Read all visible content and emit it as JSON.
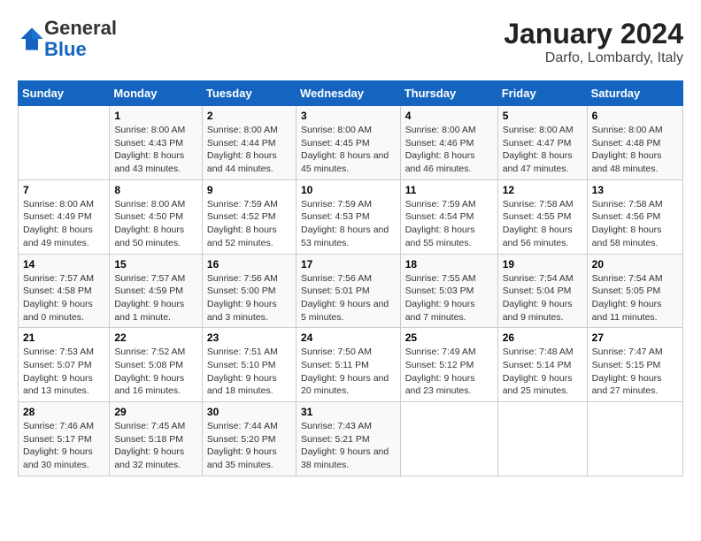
{
  "logo": {
    "general": "General",
    "blue": "Blue"
  },
  "title": "January 2024",
  "subtitle": "Darfo, Lombardy, Italy",
  "weekdays": [
    "Sunday",
    "Monday",
    "Tuesday",
    "Wednesday",
    "Thursday",
    "Friday",
    "Saturday"
  ],
  "weeks": [
    [
      {
        "num": "",
        "sunrise": "",
        "sunset": "",
        "daylight": "",
        "empty": true
      },
      {
        "num": "1",
        "sunrise": "Sunrise: 8:00 AM",
        "sunset": "Sunset: 4:43 PM",
        "daylight": "Daylight: 8 hours and 43 minutes."
      },
      {
        "num": "2",
        "sunrise": "Sunrise: 8:00 AM",
        "sunset": "Sunset: 4:44 PM",
        "daylight": "Daylight: 8 hours and 44 minutes."
      },
      {
        "num": "3",
        "sunrise": "Sunrise: 8:00 AM",
        "sunset": "Sunset: 4:45 PM",
        "daylight": "Daylight: 8 hours and 45 minutes."
      },
      {
        "num": "4",
        "sunrise": "Sunrise: 8:00 AM",
        "sunset": "Sunset: 4:46 PM",
        "daylight": "Daylight: 8 hours and 46 minutes."
      },
      {
        "num": "5",
        "sunrise": "Sunrise: 8:00 AM",
        "sunset": "Sunset: 4:47 PM",
        "daylight": "Daylight: 8 hours and 47 minutes."
      },
      {
        "num": "6",
        "sunrise": "Sunrise: 8:00 AM",
        "sunset": "Sunset: 4:48 PM",
        "daylight": "Daylight: 8 hours and 48 minutes."
      }
    ],
    [
      {
        "num": "7",
        "sunrise": "Sunrise: 8:00 AM",
        "sunset": "Sunset: 4:49 PM",
        "daylight": "Daylight: 8 hours and 49 minutes."
      },
      {
        "num": "8",
        "sunrise": "Sunrise: 8:00 AM",
        "sunset": "Sunset: 4:50 PM",
        "daylight": "Daylight: 8 hours and 50 minutes."
      },
      {
        "num": "9",
        "sunrise": "Sunrise: 7:59 AM",
        "sunset": "Sunset: 4:52 PM",
        "daylight": "Daylight: 8 hours and 52 minutes."
      },
      {
        "num": "10",
        "sunrise": "Sunrise: 7:59 AM",
        "sunset": "Sunset: 4:53 PM",
        "daylight": "Daylight: 8 hours and 53 minutes."
      },
      {
        "num": "11",
        "sunrise": "Sunrise: 7:59 AM",
        "sunset": "Sunset: 4:54 PM",
        "daylight": "Daylight: 8 hours and 55 minutes."
      },
      {
        "num": "12",
        "sunrise": "Sunrise: 7:58 AM",
        "sunset": "Sunset: 4:55 PM",
        "daylight": "Daylight: 8 hours and 56 minutes."
      },
      {
        "num": "13",
        "sunrise": "Sunrise: 7:58 AM",
        "sunset": "Sunset: 4:56 PM",
        "daylight": "Daylight: 8 hours and 58 minutes."
      }
    ],
    [
      {
        "num": "14",
        "sunrise": "Sunrise: 7:57 AM",
        "sunset": "Sunset: 4:58 PM",
        "daylight": "Daylight: 9 hours and 0 minutes."
      },
      {
        "num": "15",
        "sunrise": "Sunrise: 7:57 AM",
        "sunset": "Sunset: 4:59 PM",
        "daylight": "Daylight: 9 hours and 1 minute."
      },
      {
        "num": "16",
        "sunrise": "Sunrise: 7:56 AM",
        "sunset": "Sunset: 5:00 PM",
        "daylight": "Daylight: 9 hours and 3 minutes."
      },
      {
        "num": "17",
        "sunrise": "Sunrise: 7:56 AM",
        "sunset": "Sunset: 5:01 PM",
        "daylight": "Daylight: 9 hours and 5 minutes."
      },
      {
        "num": "18",
        "sunrise": "Sunrise: 7:55 AM",
        "sunset": "Sunset: 5:03 PM",
        "daylight": "Daylight: 9 hours and 7 minutes."
      },
      {
        "num": "19",
        "sunrise": "Sunrise: 7:54 AM",
        "sunset": "Sunset: 5:04 PM",
        "daylight": "Daylight: 9 hours and 9 minutes."
      },
      {
        "num": "20",
        "sunrise": "Sunrise: 7:54 AM",
        "sunset": "Sunset: 5:05 PM",
        "daylight": "Daylight: 9 hours and 11 minutes."
      }
    ],
    [
      {
        "num": "21",
        "sunrise": "Sunrise: 7:53 AM",
        "sunset": "Sunset: 5:07 PM",
        "daylight": "Daylight: 9 hours and 13 minutes."
      },
      {
        "num": "22",
        "sunrise": "Sunrise: 7:52 AM",
        "sunset": "Sunset: 5:08 PM",
        "daylight": "Daylight: 9 hours and 16 minutes."
      },
      {
        "num": "23",
        "sunrise": "Sunrise: 7:51 AM",
        "sunset": "Sunset: 5:10 PM",
        "daylight": "Daylight: 9 hours and 18 minutes."
      },
      {
        "num": "24",
        "sunrise": "Sunrise: 7:50 AM",
        "sunset": "Sunset: 5:11 PM",
        "daylight": "Daylight: 9 hours and 20 minutes."
      },
      {
        "num": "25",
        "sunrise": "Sunrise: 7:49 AM",
        "sunset": "Sunset: 5:12 PM",
        "daylight": "Daylight: 9 hours and 23 minutes."
      },
      {
        "num": "26",
        "sunrise": "Sunrise: 7:48 AM",
        "sunset": "Sunset: 5:14 PM",
        "daylight": "Daylight: 9 hours and 25 minutes."
      },
      {
        "num": "27",
        "sunrise": "Sunrise: 7:47 AM",
        "sunset": "Sunset: 5:15 PM",
        "daylight": "Daylight: 9 hours and 27 minutes."
      }
    ],
    [
      {
        "num": "28",
        "sunrise": "Sunrise: 7:46 AM",
        "sunset": "Sunset: 5:17 PM",
        "daylight": "Daylight: 9 hours and 30 minutes."
      },
      {
        "num": "29",
        "sunrise": "Sunrise: 7:45 AM",
        "sunset": "Sunset: 5:18 PM",
        "daylight": "Daylight: 9 hours and 32 minutes."
      },
      {
        "num": "30",
        "sunrise": "Sunrise: 7:44 AM",
        "sunset": "Sunset: 5:20 PM",
        "daylight": "Daylight: 9 hours and 35 minutes."
      },
      {
        "num": "31",
        "sunrise": "Sunrise: 7:43 AM",
        "sunset": "Sunset: 5:21 PM",
        "daylight": "Daylight: 9 hours and 38 minutes."
      },
      {
        "num": "",
        "sunrise": "",
        "sunset": "",
        "daylight": "",
        "empty": true
      },
      {
        "num": "",
        "sunrise": "",
        "sunset": "",
        "daylight": "",
        "empty": true
      },
      {
        "num": "",
        "sunrise": "",
        "sunset": "",
        "daylight": "",
        "empty": true
      }
    ]
  ]
}
